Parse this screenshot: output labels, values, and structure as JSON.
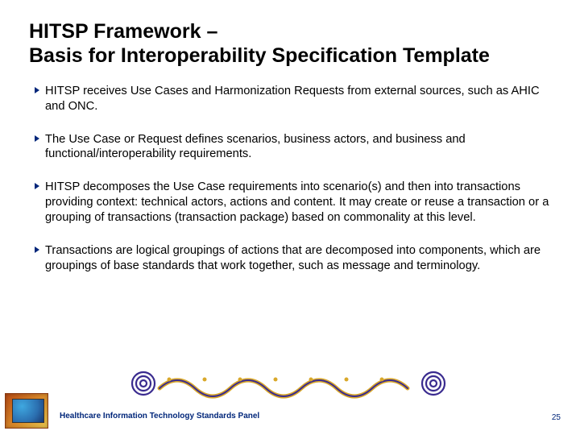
{
  "title_line1": "HITSP Framework –",
  "title_line2": "Basis for Interoperability Specification Template",
  "bullets": [
    "HITSP receives Use Cases and Harmonization Requests from external sources, such as AHIC and ONC.",
    "The Use Case or Request defines scenarios, business actors, and business and functional/interoperability requirements.",
    "HITSP decomposes the Use Case requirements into scenario(s) and then into transactions providing context: technical actors, actions and content. It may create or reuse a transaction or a grouping of transactions (transaction package) based on commonality at this level.",
    "Transactions are logical groupings of actions that are decomposed into components, which are groupings of base standards that work together, such as message and terminology."
  ],
  "footer_text": "Healthcare Information Technology Standards Panel",
  "page_number": "25",
  "colors": {
    "accent": "#00267a",
    "deco_gold": "#d9a82a",
    "deco_purple": "#3a2b8f"
  }
}
